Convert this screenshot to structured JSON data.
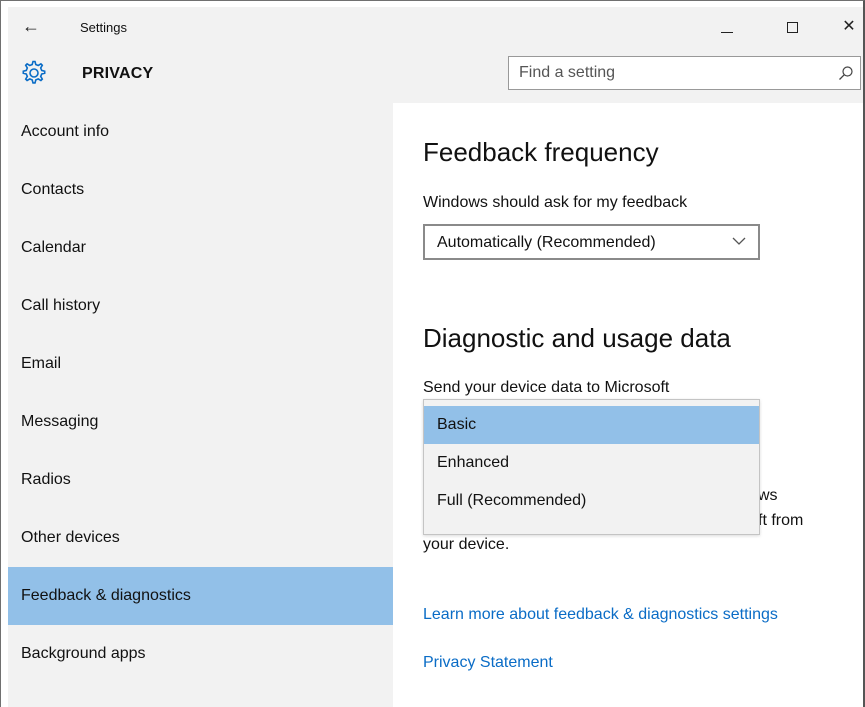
{
  "window": {
    "title": "Settings",
    "back_glyph": "←",
    "close_glyph": "✕"
  },
  "header": {
    "title": "PRIVACY",
    "icon": "gear-icon",
    "search_placeholder": "Find a setting",
    "search_value": ""
  },
  "sidebar": {
    "items": [
      {
        "label": "Account info",
        "selected": false
      },
      {
        "label": "Contacts",
        "selected": false
      },
      {
        "label": "Calendar",
        "selected": false
      },
      {
        "label": "Call history",
        "selected": false
      },
      {
        "label": "Email",
        "selected": false
      },
      {
        "label": "Messaging",
        "selected": false
      },
      {
        "label": "Radios",
        "selected": false
      },
      {
        "label": "Other devices",
        "selected": false
      },
      {
        "label": "Feedback & diagnostics",
        "selected": true
      },
      {
        "label": "Background apps",
        "selected": false
      }
    ]
  },
  "main": {
    "feedback": {
      "heading": "Feedback frequency",
      "label": "Windows should ask for my feedback",
      "selected_value": "Automatically (Recommended)"
    },
    "diagnostic": {
      "heading": "Diagnostic and usage data",
      "label": "Send your device data to Microsoft",
      "options": [
        "Basic",
        "Enhanced",
        "Full (Recommended)"
      ],
      "selected_option": "Basic",
      "partial_text_1": "ws",
      "partial_text_2": "ft from",
      "partial_text_3": "your device."
    },
    "links": {
      "learn_more": "Learn more about feedback & diagnostics settings",
      "privacy": "Privacy Statement"
    }
  },
  "colors": {
    "accent": "#0a6cc6",
    "selection": "#92c0e8",
    "chrome": "#f2f2f2"
  }
}
